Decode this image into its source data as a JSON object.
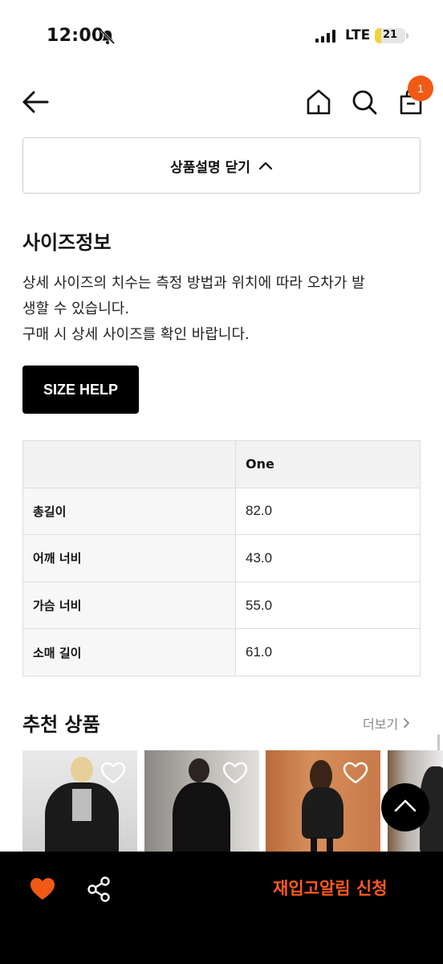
{
  "status_bar": {
    "time": "12:00",
    "network": "LTE",
    "battery": "21",
    "battery_level": 0.21,
    "icons": [
      "bell-slash-icon",
      "signal-icon"
    ]
  },
  "header": {
    "icons": [
      "back-arrow-icon",
      "home-icon",
      "search-icon",
      "shopping-bag-icon"
    ],
    "cart_count": "1"
  },
  "description_toggle": {
    "label": "상품설명 닫기",
    "icon": "chevron-up-icon"
  },
  "size_info": {
    "title": "사이즈정보",
    "description_lines": [
      "상세 사이즈의 치수는 측정 방법과 위치에 따라 오차가 발",
      "생할 수 있습니다.",
      "구매 시 상세 사이즈를 확인 바랍니다."
    ],
    "help_button": "SIZE HELP"
  },
  "size_table": {
    "columns": [
      "",
      "One"
    ],
    "rows": [
      {
        "label": "총길이",
        "value": "82.0"
      },
      {
        "label": "어깨 너비",
        "value": "43.0"
      },
      {
        "label": "가슴 너비",
        "value": "55.0"
      },
      {
        "label": "소매 길이",
        "value": "61.0"
      }
    ]
  },
  "recommendations": {
    "title": "추천 상품",
    "more_label": "더보기",
    "products": [
      {
        "icon": "heart-outline-icon"
      },
      {
        "icon": "heart-outline-icon"
      },
      {
        "icon": "heart-outline-icon"
      },
      {
        "icon": "heart-outline-icon"
      }
    ]
  },
  "bottom_bar": {
    "icons": [
      "heart-filled-icon",
      "share-icon"
    ],
    "restock_label": "재입고알림 신청"
  },
  "colors": {
    "accent": "#f05a14",
    "restock_text": "#ff5a1f",
    "bottom_bar": "#000000",
    "battery": "#f2d23c"
  }
}
